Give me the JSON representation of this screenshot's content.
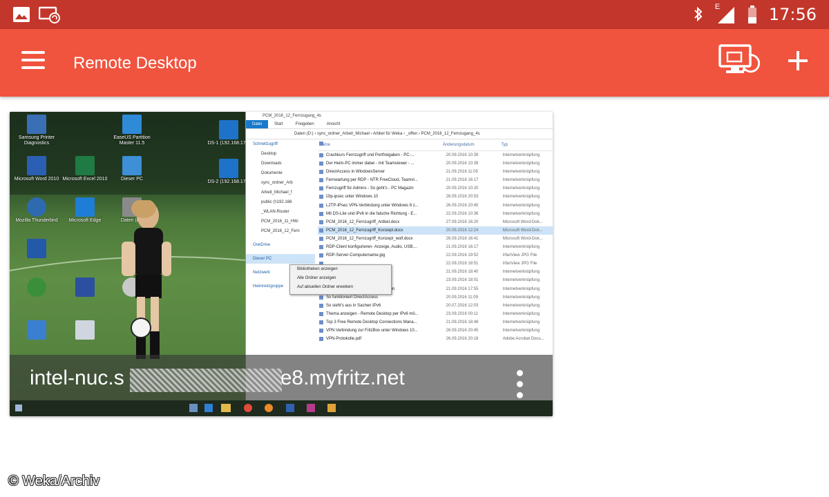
{
  "status_bar": {
    "time": "17:56",
    "network_type": "E",
    "icons": [
      "gallery-icon",
      "cast-icon",
      "bluetooth-icon",
      "signal-icon",
      "battery-icon"
    ],
    "color": "#c3362b"
  },
  "app_bar": {
    "title": "Remote Desktop",
    "color": "#f0533e",
    "actions": [
      "desktop-connect-icon",
      "add-icon"
    ]
  },
  "connection": {
    "host_prefix": "intel-nuc.s",
    "host_suffix": "e8.myfritz.net"
  },
  "thumbnail": {
    "desktop_icons": [
      {
        "label": "Samsung Printer Diagnostics",
        "color": "#3b6fb5"
      },
      {
        "label": "EaseUS Partition Master 11.5",
        "color": "#2f8ad8"
      },
      {
        "label": "DS-1 (192.168.17...",
        "color": "#1e73c8"
      },
      {
        "label": "Microsoft Word 2010",
        "color": "#2b5fb3"
      },
      {
        "label": "Microsoft Excel 2010",
        "color": "#1f7a44"
      },
      {
        "label": "Dieser PC",
        "color": "#3d8fd6"
      },
      {
        "label": "DS-2 (192.168.17...",
        "color": "#1e73c8"
      },
      {
        "label": "Mozilla Thunderbird",
        "color": "#2d6ab0"
      },
      {
        "label": "Microsoft Edge",
        "color": "#1e7ed6"
      },
      {
        "label": "Daten (D:)",
        "color": "#8a8a8a"
      }
    ],
    "explorer": {
      "title": "PCM_2016_12_Fernzugang_4s",
      "ribbon_tabs": [
        "Datei",
        "Start",
        "Freigeben",
        "Ansicht"
      ],
      "address": "Daten (D:)  ›  sync_ordner_Arbeit_Michael  ›  Artikel für Weka  ›  _offen  ›  PCM_2016_12_Fernzugang_4s",
      "nav_items": [
        "Schnellzugriff",
        "Desktop",
        "Downloads",
        "Dokumente",
        "sync_ordner_Arb",
        "Arbeit_Michael_f",
        "public (\\\\192.168",
        "_WLAN-Router",
        "PCM_2016_11_HW-",
        "PCM_2016_12_Fern",
        "OneDrive",
        "Dieser PC",
        "Netzwerk",
        "Heimnetzgruppe"
      ],
      "columns": [
        "Name",
        "Änderungsdatum",
        "Typ"
      ],
      "files": [
        {
          "name": "Crashkurs Fernzugriff und Portfreigaben - PC-...",
          "date": "20.09.2016 10:39",
          "type": "Internetverknüpfung"
        },
        {
          "name": "Der Heim-PC immer dabei - mit Teamviewer - ...",
          "date": "20.09.2016 10:39",
          "type": "Internetverknüpfung"
        },
        {
          "name": "DirectAccess in WindowsServer",
          "date": "21.09.2016 11:05",
          "type": "Internetverknüpfung"
        },
        {
          "name": "Fernwartung per RDP - NTR FreeCloud, Teamvi...",
          "date": "21.09.2016 16:17",
          "type": "Internetverknüpfung"
        },
        {
          "name": "Fernzugriff für Admins - So geht's - PC Magazin",
          "date": "20.09.2016 10:20",
          "type": "Internetverknüpfung"
        },
        {
          "name": "l2tp-ipsec unter Windows 10",
          "date": "26.09.2016 20:53",
          "type": "Internetverknüpfung"
        },
        {
          "name": "L2TP-IPsec VPN-Verbindung unter Windows 8 z...",
          "date": "26.09.2016 20:45",
          "type": "Internetverknüpfung"
        },
        {
          "name": "Mit DS-Lite und IPv6 in die falsche Richtung - E...",
          "date": "22.09.2016 10:36",
          "type": "Internetverknüpfung"
        },
        {
          "name": "PCM_2016_12_Fernzugriff_Artikel.docx",
          "date": "27.09.2016 16:20",
          "type": "Microsoft Word-Dok..."
        },
        {
          "name": "PCM_2016_12_Fernzugriff_Konzept.docx",
          "date": "20.09.2016 12:24",
          "type": "Microsoft Word-Dok...",
          "selected": true
        },
        {
          "name": "PCM_2016_12_Fernzugriff_Konzept_wolf.docx",
          "date": "26.09.2016 16:41",
          "type": "Microsoft Word-Dok..."
        },
        {
          "name": "RDP-Client konfigurieren- Anzeige, Audio, USB,...",
          "date": "21.09.2016 16:17",
          "type": "Internetverknüpfung"
        },
        {
          "name": "RDP-Server-Computername.jpg",
          "date": "22.09.2016 19:52",
          "type": "IrfanView JPG File"
        },
        {
          "name": "",
          "date": "22.09.2016 18:51",
          "type": "IrfanView JPG File"
        },
        {
          "name": "...eview - Next of...",
          "date": "21.09.2016 18:40",
          "type": "Internetverknüpfung"
        },
        {
          "name": "...ktivieren, RDP-...",
          "date": "23.09.2016 18:01",
          "type": "Internetverknüpfung"
        },
        {
          "name": "Remotedesktopverbindung einrichten",
          "date": "21.09.2016 17:55",
          "type": "Internetverknüpfung"
        },
        {
          "name": "So funktioniert DirectAccess",
          "date": "20.09.2016 11:09",
          "type": "Internetverknüpfung"
        },
        {
          "name": "So sieht's aus in Sachen IPv6",
          "date": "20.07.2016 12:03",
          "type": "Internetverknüpfung"
        },
        {
          "name": "Thema anzeigen - Remote Desktop per IPv6 mö...",
          "date": "23.09.2016 00:11",
          "type": "Internetverknüpfung"
        },
        {
          "name": "Top 3 Free Remote Desktop Connections Mana...",
          "date": "21.09.2016 18:48",
          "type": "Internetverknüpfung"
        },
        {
          "name": "VPN Verbindung zur FritzBox unter Windows 10...",
          "date": "26.09.2016 20:45",
          "type": "Internetverknüpfung"
        },
        {
          "name": "VPN-Protokolle.pdf",
          "date": "26.09.2016 20:18",
          "type": "Adobe Acrobat Docu..."
        }
      ],
      "context_menu": [
        "Bibliotheken anzeigen",
        "Alle Ordner anzeigen",
        "Auf aktuellen Ordner erweitern"
      ]
    }
  },
  "watermark": "© Weka/Archiv"
}
